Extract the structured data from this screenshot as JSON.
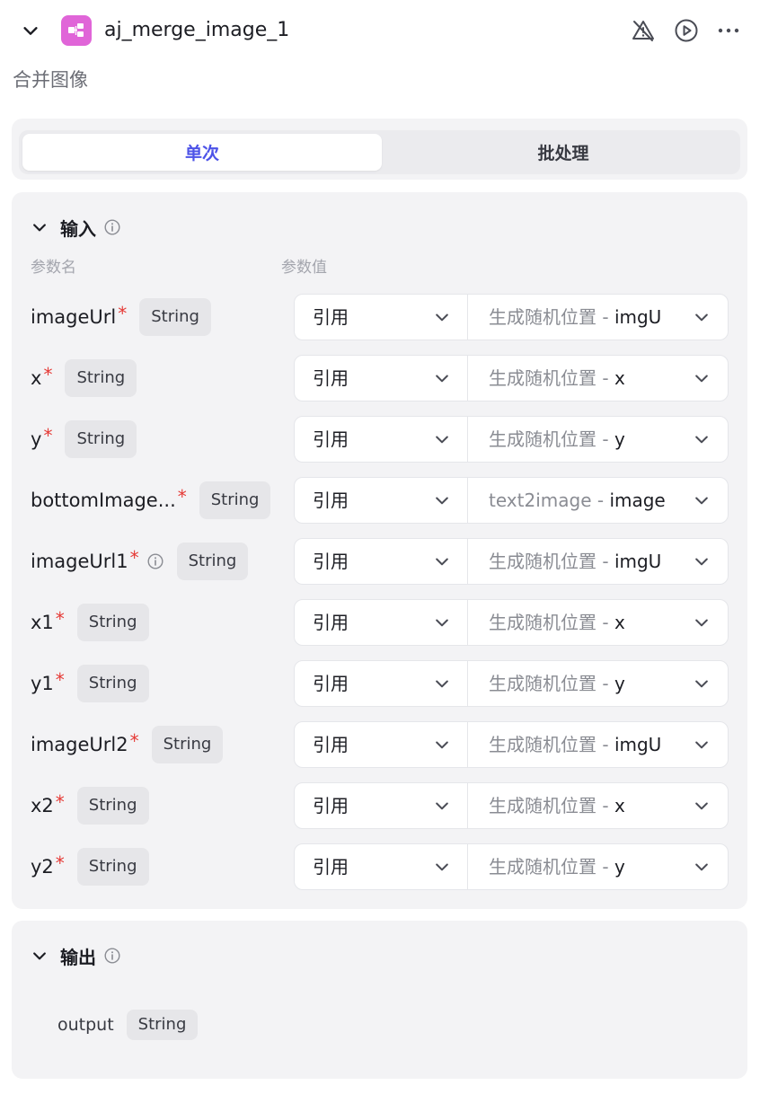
{
  "node": {
    "title": "aj_merge_image_1",
    "subtitle": "合并图像",
    "icon_color": "#e065d8"
  },
  "tabs": [
    {
      "label": "单次",
      "active": true
    },
    {
      "label": "批处理",
      "active": false
    }
  ],
  "input": {
    "title": "输入",
    "col_name": "参数名",
    "col_value": "参数值",
    "params": [
      {
        "name": "imageUrl",
        "required": true,
        "info": false,
        "type": "String",
        "mode": "引用",
        "source": "生成随机位置",
        "field": "imgU"
      },
      {
        "name": "x",
        "required": true,
        "info": false,
        "type": "String",
        "mode": "引用",
        "source": "生成随机位置",
        "field": "x"
      },
      {
        "name": "y",
        "required": true,
        "info": false,
        "type": "String",
        "mode": "引用",
        "source": "生成随机位置",
        "field": "y"
      },
      {
        "name": "bottomImage...",
        "required": true,
        "info": false,
        "type": "String",
        "mode": "引用",
        "source": "text2image",
        "field": "image"
      },
      {
        "name": "imageUrl1",
        "required": true,
        "info": true,
        "type": "String",
        "mode": "引用",
        "source": "生成随机位置",
        "field": "imgU"
      },
      {
        "name": "x1",
        "required": true,
        "info": false,
        "type": "String",
        "mode": "引用",
        "source": "生成随机位置",
        "field": "x"
      },
      {
        "name": "y1",
        "required": true,
        "info": false,
        "type": "String",
        "mode": "引用",
        "source": "生成随机位置",
        "field": "y"
      },
      {
        "name": "imageUrl2",
        "required": true,
        "info": false,
        "type": "String",
        "mode": "引用",
        "source": "生成随机位置",
        "field": "imgU"
      },
      {
        "name": "x2",
        "required": true,
        "info": false,
        "type": "String",
        "mode": "引用",
        "source": "生成随机位置",
        "field": "x"
      },
      {
        "name": "y2",
        "required": true,
        "info": false,
        "type": "String",
        "mode": "引用",
        "source": "生成随机位置",
        "field": "y"
      }
    ]
  },
  "output": {
    "title": "输出",
    "items": [
      {
        "name": "output",
        "type": "String"
      }
    ]
  },
  "colors": {
    "accent": "#4d53e8",
    "required": "#e53935",
    "panel_bg": "#f3f3f5"
  }
}
